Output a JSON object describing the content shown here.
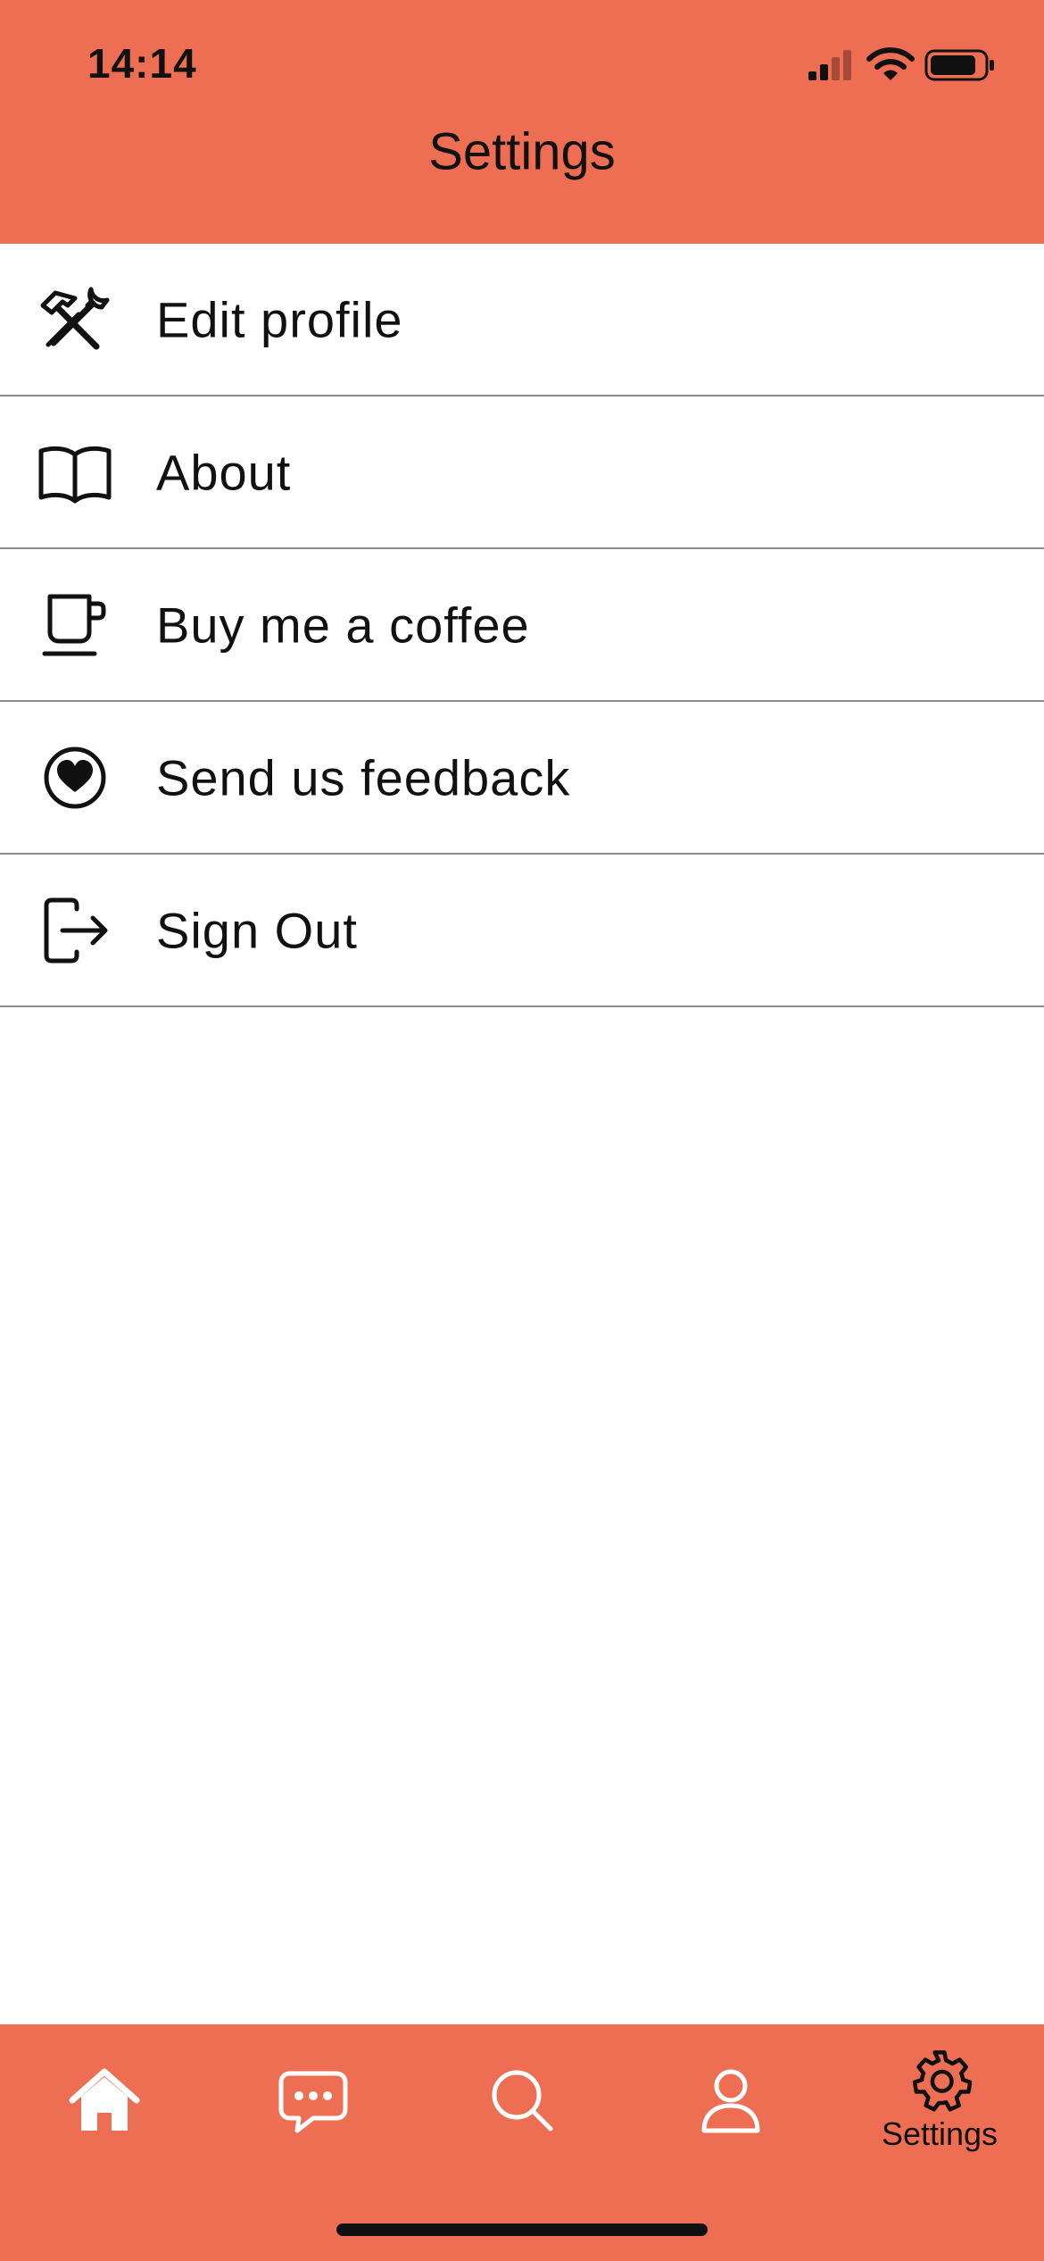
{
  "status_bar": {
    "time": "14:14",
    "icons": [
      "signal-icon",
      "wifi-icon",
      "battery-icon"
    ]
  },
  "header": {
    "title": "Settings",
    "background": "#ee6e54"
  },
  "settings_items": [
    {
      "label": "Edit profile",
      "icon": "tools-icon"
    },
    {
      "label": "About",
      "icon": "book-icon"
    },
    {
      "label": "Buy me a coffee",
      "icon": "coffee-cup-icon"
    },
    {
      "label": "Send us feedback",
      "icon": "heart-circle-icon"
    },
    {
      "label": "Sign Out",
      "icon": "sign-out-icon"
    }
  ],
  "tabbar": {
    "background": "#ee6e54",
    "tabs": [
      {
        "icon": "home-icon",
        "label": "",
        "active": false
      },
      {
        "icon": "chat-icon",
        "label": "",
        "active": false
      },
      {
        "icon": "search-icon",
        "label": "",
        "active": false
      },
      {
        "icon": "profile-icon",
        "label": "",
        "active": false
      },
      {
        "icon": "gear-icon",
        "label": "Settings",
        "active": true
      }
    ]
  }
}
